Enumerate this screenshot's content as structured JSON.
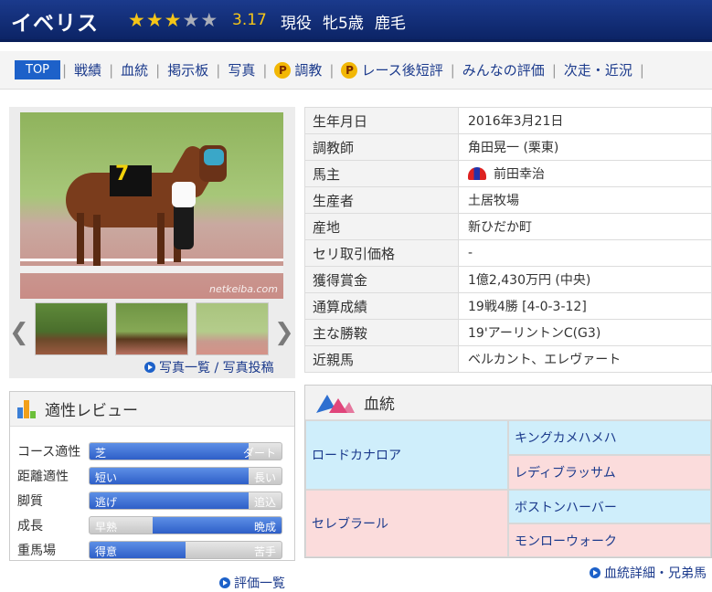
{
  "header": {
    "horse_name": "イベリス",
    "stars_on": 3,
    "stars_total": 5,
    "rating": "3.17",
    "status": [
      "現役",
      "牝5歳",
      "鹿毛"
    ]
  },
  "nav": {
    "top": "TOP",
    "items": [
      "戦績",
      "血統",
      "掲示板",
      "写真",
      "調教",
      "レース後短評",
      "みんなの評価",
      "次走・近況"
    ],
    "p_mark": "P"
  },
  "photo": {
    "watermark": "netkeiba.com",
    "cloth_number": "7",
    "links_label": "写真一覧 / 写真投稿"
  },
  "profile": {
    "rows": [
      {
        "label": "生年月日",
        "value": "2016年3月21日"
      },
      {
        "label": "調教師",
        "value": "角田晃一 (栗東)"
      },
      {
        "label": "馬主",
        "value": "前田幸治"
      },
      {
        "label": "生産者",
        "value": "土居牧場"
      },
      {
        "label": "産地",
        "value": "新ひだか町"
      },
      {
        "label": "セリ取引価格",
        "value": "-"
      },
      {
        "label": "獲得賞金",
        "value": "1億2,430万円 (中央)"
      },
      {
        "label": "通算成績",
        "value": "19戦4勝 [4-0-3-12]"
      },
      {
        "label": "主な勝鞍",
        "value": "19'アーリントンC(G3)"
      },
      {
        "label": "近親馬",
        "value": "ベルカント、エレヴァート"
      }
    ]
  },
  "review": {
    "title": "適性レビュー",
    "link": "評価一覧",
    "rows": [
      {
        "label": "コース適性",
        "left": "芝",
        "right": "ダート",
        "fill_start": 0.0,
        "fill_end": 0.83
      },
      {
        "label": "距離適性",
        "left": "短い",
        "right": "長い",
        "fill_start": 0.0,
        "fill_end": 0.83
      },
      {
        "label": "脚質",
        "left": "逃げ",
        "right": "追込",
        "fill_start": 0.0,
        "fill_end": 0.83
      },
      {
        "label": "成長",
        "left": "早熟",
        "right": "晩成",
        "fill_start": 0.33,
        "fill_end": 1.0
      },
      {
        "label": "重馬場",
        "left": "得意",
        "right": "苦手",
        "fill_start": 0.0,
        "fill_end": 0.5
      }
    ]
  },
  "pedigree": {
    "title": "血統",
    "link": "血統詳細・兄弟馬",
    "sire": "ロードカナロア",
    "dam": "セレブラール",
    "sire_sire": "キングカメハメハ",
    "sire_dam": "レディブラッサム",
    "dam_sire": "ボストンハーバー",
    "dam_dam": "モンローウォーク"
  },
  "colors": {
    "header_bg": "#1b3a8c",
    "link": "#1b3a8c",
    "accent_blue": "#1d61c9",
    "star": "#f5c518",
    "male_bg": "#cfeefb",
    "female_bg": "#fbdcdc"
  }
}
